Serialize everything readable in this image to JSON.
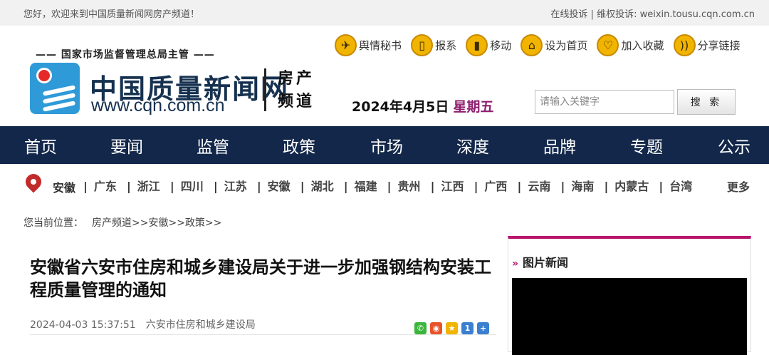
{
  "topbar": {
    "welcome": "您好，欢迎来到中国质量新闻网房产频道！",
    "online_complaint": "在线投诉",
    "separator": "|",
    "rights_label": "维权投诉: weixin.tousu.cqn.com.cn"
  },
  "header": {
    "supervisor": "—— 国家市场监督管理总局主管 ——",
    "site_name": "中国质量新闻网",
    "site_url": "www.cqn.com.cn",
    "channel_line1": "房产",
    "channel_line2": "频道",
    "tools": [
      {
        "label": "舆情秘书",
        "icon": "bird-icon"
      },
      {
        "label": "报系",
        "icon": "document-icon"
      },
      {
        "label": "移动",
        "icon": "mobile-icon"
      },
      {
        "label": "设为首页",
        "icon": "home-icon"
      },
      {
        "label": "加入收藏",
        "icon": "heart-icon"
      },
      {
        "label": "分享链接",
        "icon": "rss-icon"
      }
    ],
    "date": "2024年4月5日",
    "weekday": "星期五",
    "search_placeholder": "请输入关键字",
    "search_button": "搜 索"
  },
  "nav": [
    "首页",
    "要闻",
    "监管",
    "政策",
    "市场",
    "深度",
    "品牌",
    "专题",
    "公示"
  ],
  "region": {
    "current": "安徽",
    "list": [
      "广东",
      "浙江",
      "四川",
      "江苏",
      "安徽",
      "湖北",
      "福建",
      "贵州",
      "江西",
      "广西",
      "云南",
      "海南",
      "内蒙古",
      "台湾"
    ],
    "more": "更多"
  },
  "breadcrumb": {
    "label": "您当前位置：",
    "path": "房产频道>>安徽>>政策>>"
  },
  "article": {
    "title": "安徽省六安市住房和城乡建设局关于进一步加强钢结构安装工程质量管理的通知",
    "datetime": "2024-04-03 15:37:51",
    "source": "六安市住房和城乡建设局"
  },
  "sidebar": {
    "heading": "图片新闻"
  },
  "colors": {
    "nav_bg": "#122749",
    "accent_magenta": "#b8156e",
    "logo_blue": "#2f9ad8",
    "tool_icon": "#f1b400"
  }
}
